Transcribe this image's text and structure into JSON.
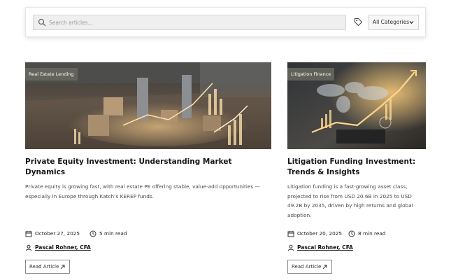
{
  "search": {
    "placeholder": "Search articles...",
    "category_selected": "All Categories"
  },
  "articles": [
    {
      "category": "Real Estate Lending",
      "title": "Private Equity Investment: Understanding Market Dynamics",
      "excerpt": "Private equity is growing fast, with real estate PE offering stable, value-add opportunities — especially in Europe through Katch’s KEREP funds.",
      "date": "October 27, 2025",
      "read_time": "5 min read",
      "author": "Pascal Rohner, CFA",
      "cta": "Read Article"
    },
    {
      "category": "Litigation Finance",
      "title": "Litigation Funding Investment: Trends & Insights",
      "excerpt": "Litigation funding is a fast-growing asset class, projected to rise from USD 20.6B in 2025 to USD 49.2B by 2035, driven by high returns and global adoption.",
      "date": "October 20, 2025",
      "read_time": "8 min read",
      "author": "Pascal Rohner, CFA",
      "cta": "Read Article"
    }
  ],
  "icons": [
    "search-icon",
    "tag-icon",
    "chevron-down-icon",
    "calendar-icon",
    "clock-icon",
    "user-icon",
    "arrow-up-right-icon"
  ],
  "colors": {
    "badge_bg": "#69695f",
    "panel_border": "#e6e6e6",
    "input_bg": "#efefef",
    "text": "#161616"
  }
}
